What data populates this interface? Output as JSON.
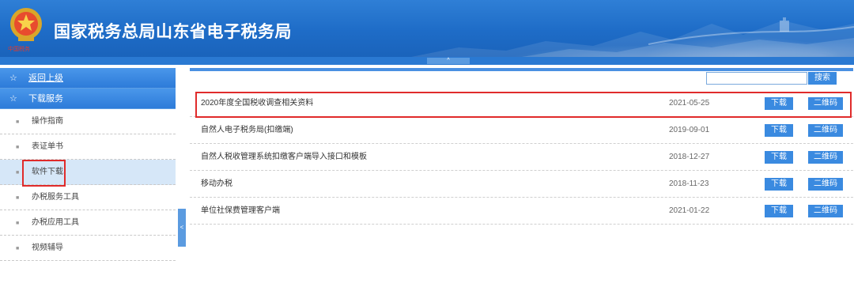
{
  "header": {
    "title": "国家税务总局山东省电子税务局",
    "emblem_caption": "中国税务",
    "collapse_arrow": "^"
  },
  "sidebar": {
    "back": {
      "icon": "☆",
      "label": "返回上级"
    },
    "section": {
      "icon": "☆",
      "label": "下载服务"
    },
    "items": [
      {
        "label": "操作指南",
        "bullet": "■"
      },
      {
        "label": "表证单书",
        "bullet": "■"
      },
      {
        "label": "软件下载",
        "bullet": "■",
        "active": true
      },
      {
        "label": "办税服务工具",
        "bullet": "■"
      },
      {
        "label": "办税应用工具",
        "bullet": "■"
      },
      {
        "label": "视频辅导",
        "bullet": "■"
      }
    ],
    "toggle": "<"
  },
  "search": {
    "placeholder": "",
    "button": "搜索"
  },
  "downloads": [
    {
      "name": "2020年度全国税收调查相关资料",
      "date": "2021-05-25",
      "download": "下载",
      "qr": "二维码"
    },
    {
      "name": "自然人电子税务局(扣缴端)",
      "date": "2019-09-01",
      "download": "下载",
      "qr": "二维码"
    },
    {
      "name": "自然人税收管理系统扣缴客户端导入接口和模板",
      "date": "2018-12-27",
      "download": "下载",
      "qr": "二维码"
    },
    {
      "name": "移动办税",
      "date": "2018-11-23",
      "download": "下载",
      "qr": "二维码"
    },
    {
      "name": "单位社保费管理客户端",
      "date": "2021-01-22",
      "download": "下载",
      "qr": "二维码"
    }
  ],
  "colors": {
    "header": "#1e6cc7",
    "button": "#3a8ae0",
    "highlight": "#e02b2b",
    "active": "#d6e7f8"
  }
}
